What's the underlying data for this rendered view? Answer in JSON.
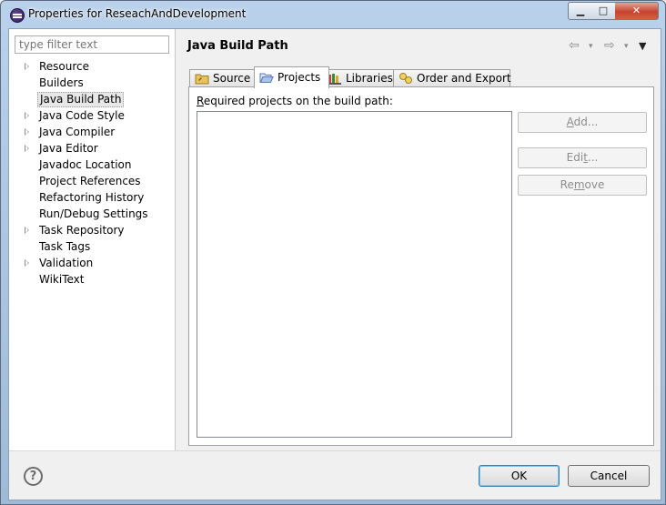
{
  "window": {
    "title": "Properties for ReseachAndDevelopment",
    "minimize_glyph": "▁",
    "maximize_glyph": "□",
    "close_glyph": "✕"
  },
  "filter": {
    "placeholder": "type filter text",
    "value": ""
  },
  "tree": {
    "items": [
      {
        "label": "Resource",
        "expandable": true
      },
      {
        "label": "Builders",
        "expandable": false
      },
      {
        "label": "Java Build Path",
        "expandable": false,
        "selected": true
      },
      {
        "label": "Java Code Style",
        "expandable": true
      },
      {
        "label": "Java Compiler",
        "expandable": true
      },
      {
        "label": "Java Editor",
        "expandable": true
      },
      {
        "label": "Javadoc Location",
        "expandable": false
      },
      {
        "label": "Project References",
        "expandable": false
      },
      {
        "label": "Refactoring History",
        "expandable": false
      },
      {
        "label": "Run/Debug Settings",
        "expandable": false
      },
      {
        "label": "Task Repository",
        "expandable": true
      },
      {
        "label": "Task Tags",
        "expandable": false
      },
      {
        "label": "Validation",
        "expandable": true
      },
      {
        "label": "WikiText",
        "expandable": false
      }
    ]
  },
  "page": {
    "title": "Java Build Path",
    "nav": {
      "back_glyph": "⇦",
      "forward_glyph": "⇨",
      "menu_glyph": "▾",
      "view_menu_glyph": "▼"
    }
  },
  "tabs": {
    "source": "Source",
    "projects": "Projects",
    "libraries": "Libraries",
    "order": "Order and Export",
    "active": "projects"
  },
  "projects_tab": {
    "label_first": "R",
    "label_rest": "equired projects on the build path:",
    "items": [],
    "buttons": {
      "add_u": "A",
      "add_rest": "dd...",
      "edit_pre": "Edi",
      "edit_u": "t",
      "edit_post": "...",
      "remove_pre": "Re",
      "remove_u": "m",
      "remove_post": "ove"
    }
  },
  "footer": {
    "help_glyph": "?",
    "ok": "OK",
    "cancel": "Cancel"
  },
  "colors": {
    "titlebar": "#b9d1ea",
    "close_button": "#c7432f",
    "disabled_text": "#8d8d8d",
    "default_button_border": "#3c7fb1"
  }
}
